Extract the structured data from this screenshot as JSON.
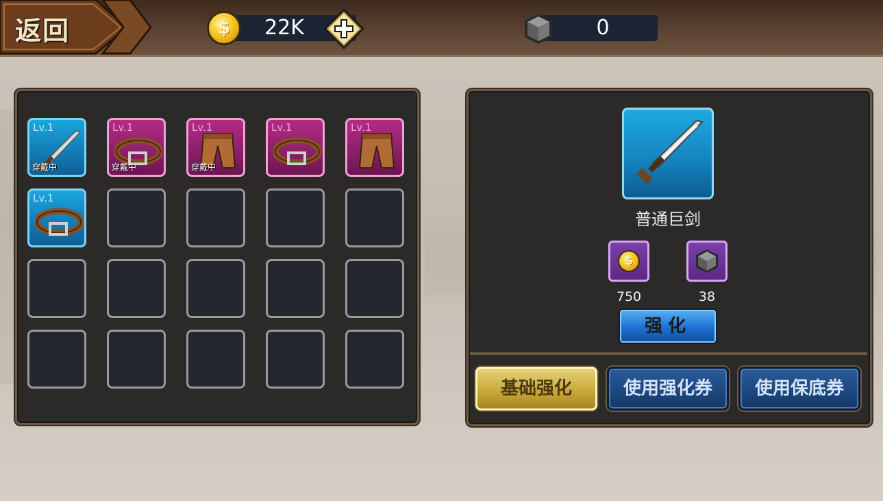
{
  "topbar": {
    "back_label": "返回",
    "gold": {
      "value": "22K",
      "icon": "gold-coin-icon",
      "add_icon": "plus-icon"
    },
    "material": {
      "value": "0",
      "icon": "iron-cube-icon"
    }
  },
  "inventory": {
    "slots": [
      {
        "level": "Lv.1",
        "item": "sword-icon",
        "rarity": "blue",
        "status": "穿戴中"
      },
      {
        "level": "Lv.1",
        "item": "belt-icon",
        "rarity": "pink",
        "status": "穿戴中"
      },
      {
        "level": "Lv.1",
        "item": "pants-icon",
        "rarity": "pink",
        "status": "穿戴中"
      },
      {
        "level": "Lv.1",
        "item": "belt-icon",
        "rarity": "pink",
        "status": ""
      },
      {
        "level": "Lv.1",
        "item": "pants-icon",
        "rarity": "pink",
        "status": ""
      },
      {
        "level": "Lv.1",
        "item": "belt-icon",
        "rarity": "blue",
        "status": ""
      }
    ],
    "empty_slot_count": 14
  },
  "detail": {
    "item_name": "普通巨剑",
    "item_icon": "sword-icon",
    "cost_gold": "750",
    "cost_material": "38",
    "enhance_label": "强化"
  },
  "modes": {
    "basic": "基础强化",
    "ticket": "使用强化券",
    "guarantee": "使用保底券"
  },
  "colors": {
    "rarity_blue": "#1582bd",
    "rarity_pink": "#8b1f68",
    "active_mode": "#c9a93a",
    "inactive_mode": "#1d467e"
  }
}
